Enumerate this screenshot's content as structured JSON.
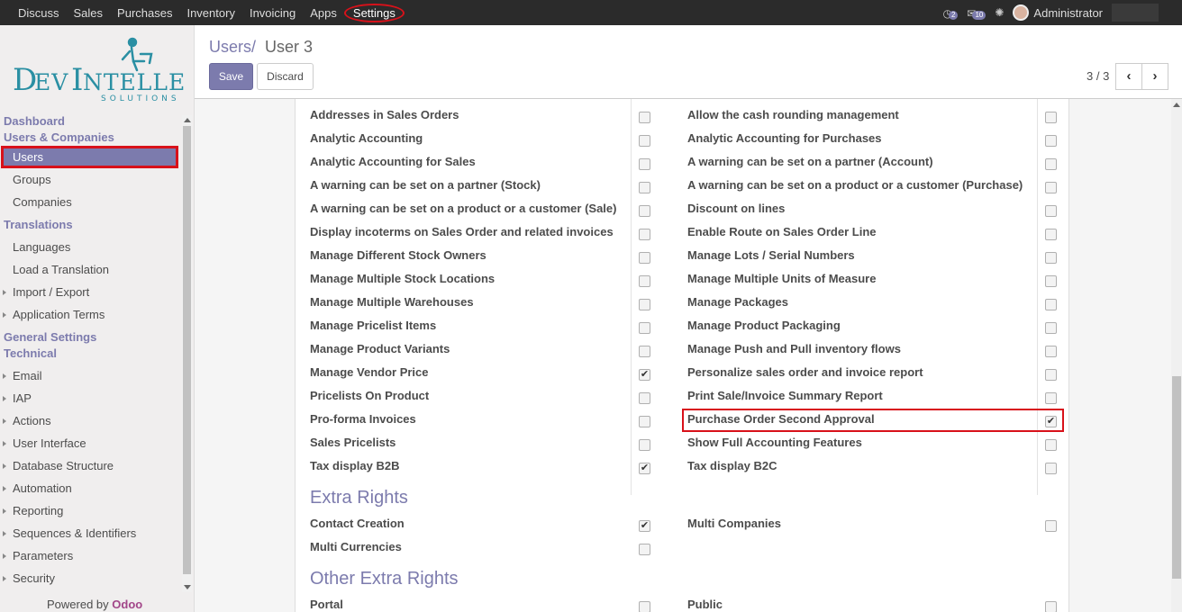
{
  "topbar": {
    "menu": [
      "Discuss",
      "Sales",
      "Purchases",
      "Inventory",
      "Invoicing",
      "Apps",
      "Settings"
    ],
    "activity_count": "2",
    "message_count": "10",
    "user": "Administrator"
  },
  "sidebar": {
    "logo_main": "DevIntelle",
    "logo_sub": "SOLUTIONS",
    "sections": [
      {
        "header": "Dashboard",
        "items": []
      },
      {
        "header": "Users & Companies",
        "items": [
          "Users",
          "Groups",
          "Companies"
        ]
      },
      {
        "header": "Translations",
        "items": [
          "Languages",
          "Load a Translation",
          "Import / Export",
          "Application Terms"
        ]
      },
      {
        "header": "General Settings",
        "items": []
      },
      {
        "header": "Technical",
        "items": [
          "Email",
          "IAP",
          "Actions",
          "User Interface",
          "Database Structure",
          "Automation",
          "Reporting",
          "Sequences & Identifiers",
          "Parameters",
          "Security"
        ]
      }
    ],
    "powered_by": "Powered by",
    "powered_brand": "Odoo"
  },
  "control": {
    "breadcrumb_parent": "Users",
    "breadcrumb_sep": "/",
    "breadcrumb_current": "User 3",
    "save_label": "Save",
    "discard_label": "Discard",
    "pager": "3 / 3"
  },
  "left_col": [
    {
      "label": "Addresses in Sales Orders",
      "checked": false
    },
    {
      "label": "Analytic Accounting",
      "checked": false
    },
    {
      "label": "Analytic Accounting for Sales",
      "checked": false
    },
    {
      "label": "A warning can be set on a partner (Stock)",
      "checked": false
    },
    {
      "label": "A warning can be set on a product or a customer (Sale)",
      "checked": false
    },
    {
      "label": "Display incoterms on Sales Order and related invoices",
      "checked": false
    },
    {
      "label": "Manage Different Stock Owners",
      "checked": false
    },
    {
      "label": "Manage Multiple Stock Locations",
      "checked": false
    },
    {
      "label": "Manage Multiple Warehouses",
      "checked": false
    },
    {
      "label": "Manage Pricelist Items",
      "checked": false
    },
    {
      "label": "Manage Product Variants",
      "checked": false
    },
    {
      "label": "Manage Vendor Price",
      "checked": true
    },
    {
      "label": "Pricelists On Product",
      "checked": false
    },
    {
      "label": "Pro-forma Invoices",
      "checked": false
    },
    {
      "label": "Sales Pricelists",
      "checked": false
    },
    {
      "label": "Tax display B2B",
      "checked": true
    }
  ],
  "right_col": [
    {
      "label": "Allow the cash rounding management",
      "checked": false
    },
    {
      "label": "Analytic Accounting for Purchases",
      "checked": false
    },
    {
      "label": "A warning can be set on a partner (Account)",
      "checked": false
    },
    {
      "label": "A warning can be set on a product or a customer (Purchase)",
      "checked": false
    },
    {
      "label": "Discount on lines",
      "checked": false
    },
    {
      "label": "Enable Route on Sales Order Line",
      "checked": false
    },
    {
      "label": "Manage Lots / Serial Numbers",
      "checked": false
    },
    {
      "label": "Manage Multiple Units of Measure",
      "checked": false
    },
    {
      "label": "Manage Packages",
      "checked": false
    },
    {
      "label": "Manage Product Packaging",
      "checked": false
    },
    {
      "label": "Manage Push and Pull inventory flows",
      "checked": false
    },
    {
      "label": "Personalize sales order and invoice report",
      "checked": false
    },
    {
      "label": "Print Sale/Invoice Summary Report",
      "checked": false
    },
    {
      "label": "Purchase Order Second Approval",
      "checked": true
    },
    {
      "label": "Show Full Accounting Features",
      "checked": false
    },
    {
      "label": "Tax display B2C",
      "checked": false
    }
  ],
  "extra_rights": {
    "title": "Extra Rights",
    "left": [
      {
        "label": "Contact Creation",
        "checked": true
      },
      {
        "label": "Multi Currencies",
        "checked": false
      }
    ],
    "right": [
      {
        "label": "Multi Companies",
        "checked": false
      }
    ]
  },
  "other_extra_rights": {
    "title": "Other Extra Rights",
    "left": [
      {
        "label": "Portal",
        "checked": false
      }
    ],
    "right": [
      {
        "label": "Public",
        "checked": false
      }
    ]
  }
}
